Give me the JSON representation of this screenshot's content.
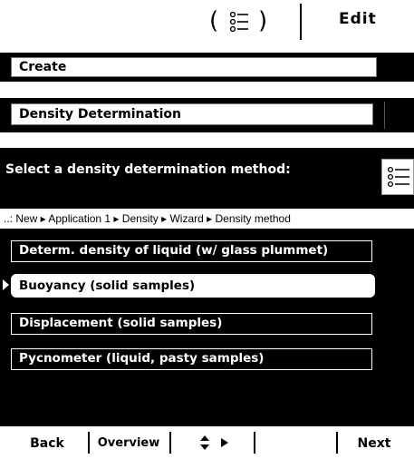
{
  "topbar": {
    "open_paren": "(",
    "close_paren": ")",
    "edit_label": "Edit"
  },
  "fields": {
    "create": "Create",
    "density_determination": "Density Determination"
  },
  "panel": {
    "prompt": "Select a density determination method:",
    "breadcrumb": "..: New ▸ Application 1 ▸ Density ▸ Wizard ▸ Density method",
    "options": [
      {
        "label": "Determ. density of liquid (w/ glass plummet)"
      },
      {
        "label": "Buoyancy (solid samples)"
      },
      {
        "label": "Displacement (solid samples)"
      },
      {
        "label": "Pycnometer (liquid, pasty samples)"
      }
    ],
    "selected_index": 1
  },
  "softkeys": {
    "back": "Back",
    "overview": "Overview",
    "nav": "⬍ ▸",
    "blank": "",
    "next": "Next"
  },
  "icons": {
    "menu_list": "list-icon",
    "selection_arrow": "triangle-right-icon",
    "updown": "updown-arrow-icon"
  },
  "colors": {
    "panel_bg": "#000000",
    "text_light": "#ffffff",
    "background": "#ffffff"
  }
}
